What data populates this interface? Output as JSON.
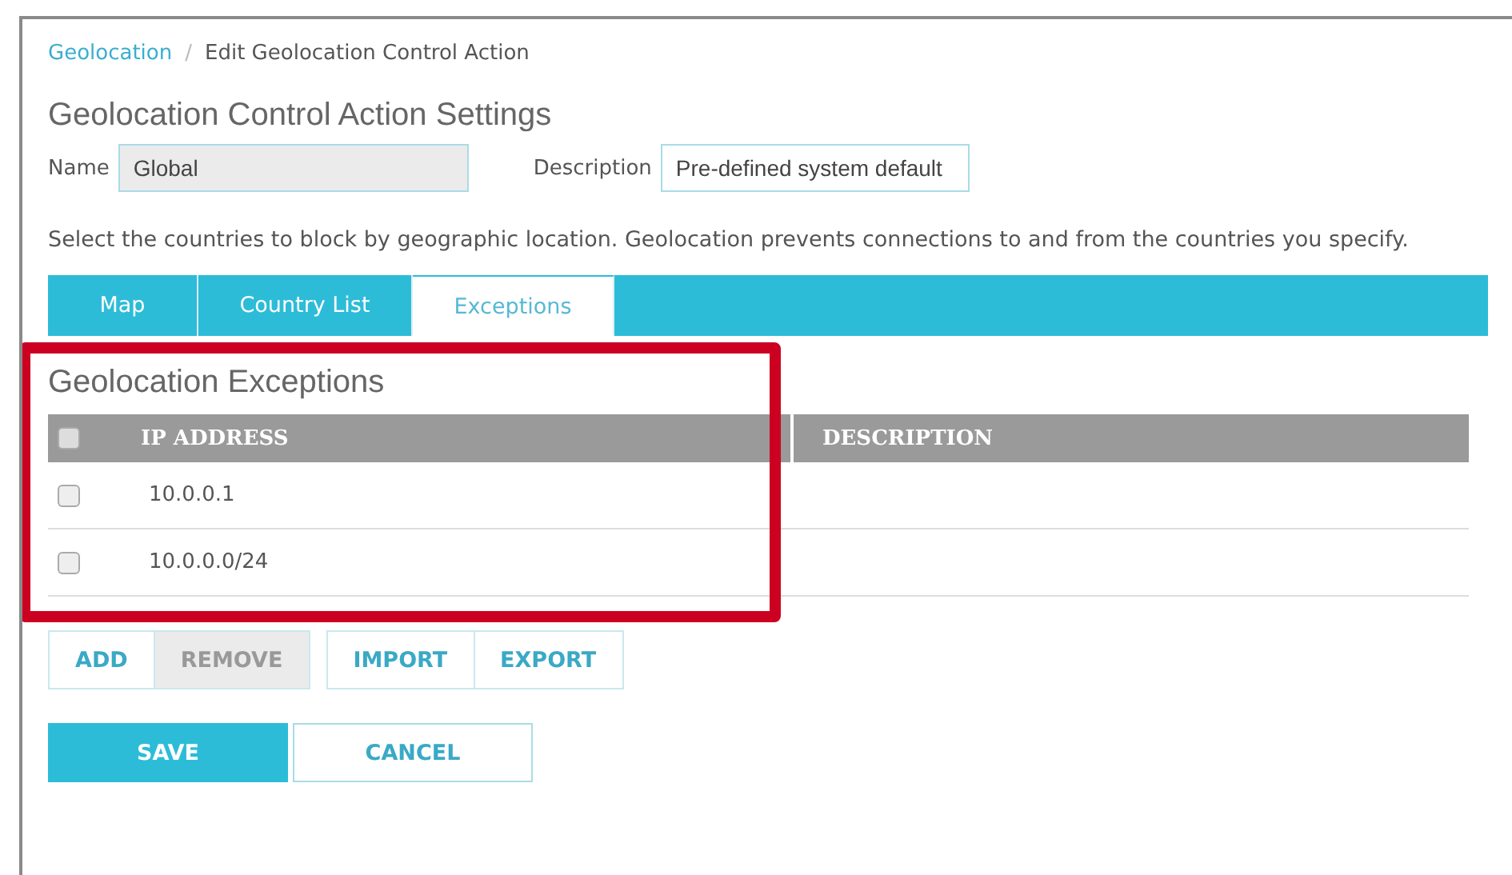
{
  "breadcrumb": [
    {
      "label": "Geolocation",
      "link": true
    },
    {
      "label": "Edit Geolocation Control Action",
      "link": false
    }
  ],
  "breadcrumb_separator": "/",
  "title": "Geolocation Control Action Settings",
  "fields": [
    {
      "label": "Name",
      "value": "Global",
      "disabled": true
    },
    {
      "label": "Description",
      "value": "Pre-defined system default",
      "disabled": false
    }
  ],
  "intro": "Select the countries to block by geographic location. Geolocation prevents connections to and from the countries you specify.",
  "tabs": [
    {
      "label": "Map",
      "selected": false
    },
    {
      "label": "Country List",
      "selected": false
    },
    {
      "label": "Exceptions",
      "selected": true
    }
  ],
  "exceptions": {
    "title": "Geolocation Exceptions",
    "highlighted": true,
    "select_all_checked": false,
    "columns": [
      "IP ADDRESS",
      "DESCRIPTION"
    ],
    "rows": [
      {
        "ip": "10.0.0.1",
        "checked": false
      },
      {
        "ip": "10.0.0.0/24",
        "checked": false
      }
    ]
  },
  "action_groups": [
    [
      {
        "label": "ADD",
        "disabled": false
      },
      {
        "label": "REMOVE",
        "disabled": true
      }
    ],
    [
      {
        "label": "IMPORT",
        "disabled": false
      },
      {
        "label": "EXPORT",
        "disabled": false
      }
    ]
  ],
  "form_buttons": [
    {
      "label": "SAVE",
      "primary": true
    },
    {
      "label": "CANCEL",
      "primary": false
    }
  ]
}
